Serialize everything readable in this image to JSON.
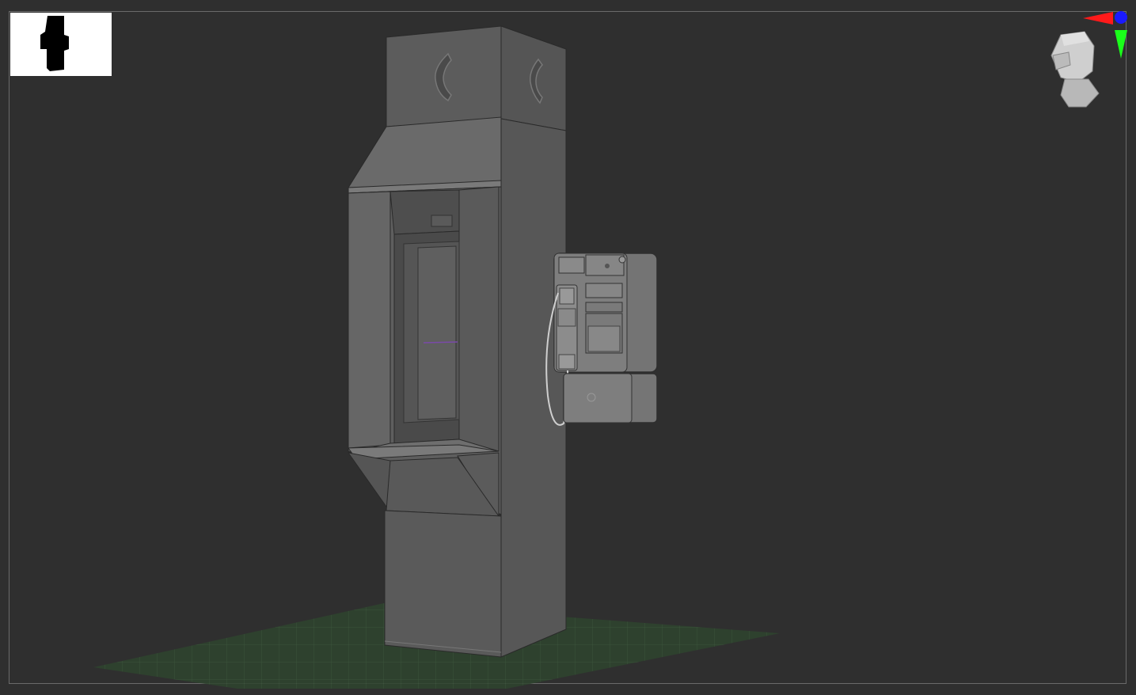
{
  "viewport": {
    "background": "#2f2f2f",
    "frame_color": "#6a6a6a",
    "floor_grid_color": "#2f4a2f"
  },
  "thumbnail": {
    "icon": "silhouette-thumbnail-icon",
    "background": "#ffffff"
  },
  "navigation_gizmo": {
    "icon": "head-orientation-icon",
    "axis_colors": {
      "x": "#ff1a1a",
      "y": "#1aff1a",
      "z": "#1a1aff"
    }
  },
  "model": {
    "name_icon": "payphone-booth-model",
    "booth_symbol_icon": "phone-handset-symbol-icon",
    "body_color": "#5a5a5a",
    "highlight_color": "#6e6e6e",
    "shadow_color": "#3e3e3e",
    "payphone_color": "#7a7a7a"
  }
}
